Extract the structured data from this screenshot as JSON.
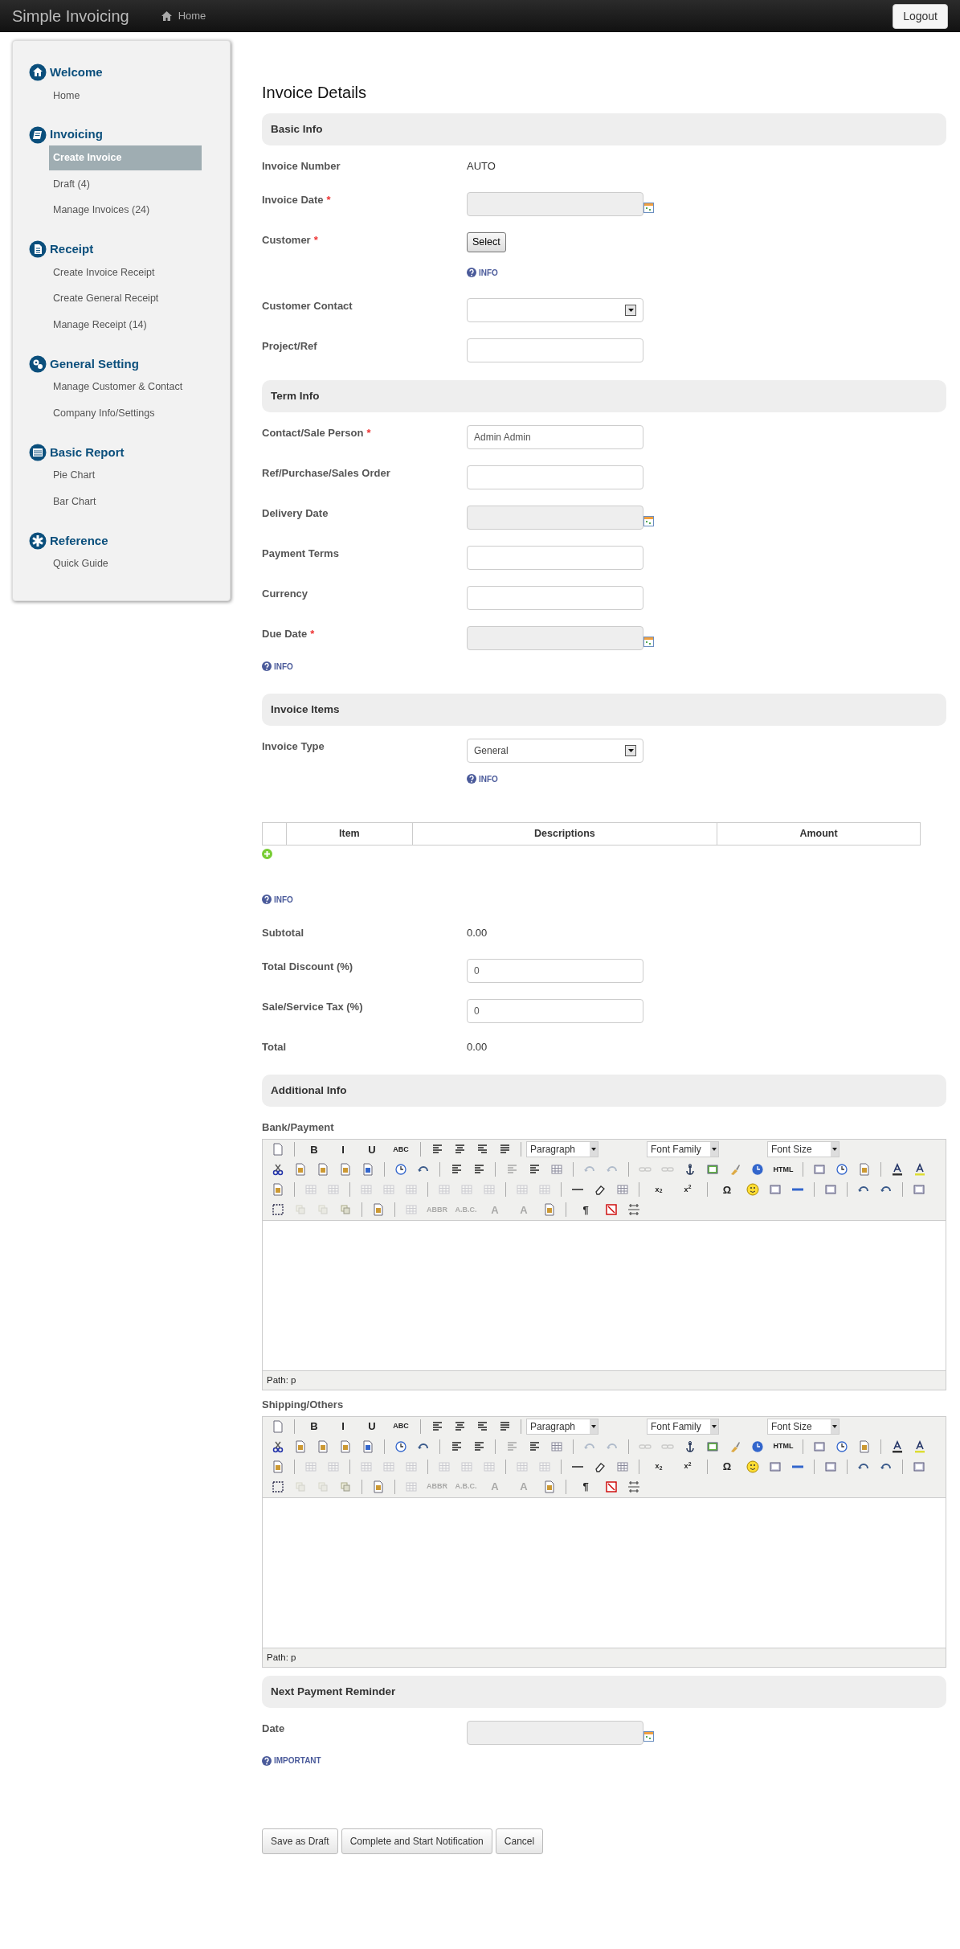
{
  "navbar": {
    "brand": "Simple Invoicing",
    "links": [
      {
        "label": "Home",
        "selected": false
      }
    ],
    "logout": "Logout"
  },
  "sidebar": {
    "groups": [
      {
        "kind": "home",
        "title": "Welcome",
        "items": [
          {
            "label": "Home",
            "selected": false
          }
        ]
      },
      {
        "kind": "invoice",
        "title": "Invoicing",
        "items": [
          {
            "label": "Create Invoice",
            "selected": true
          },
          {
            "label": "Draft (4)",
            "selected": false
          },
          {
            "label": "Manage Invoices (24)",
            "selected": false
          }
        ]
      },
      {
        "kind": "receipt",
        "title": "Receipt",
        "items": [
          {
            "label": "Create Invoice Receipt",
            "selected": false
          },
          {
            "label": "Create General Receipt",
            "selected": false
          },
          {
            "label": "Manage Receipt (14)",
            "selected": false
          }
        ]
      },
      {
        "kind": "setting",
        "title": "General Setting",
        "items": [
          {
            "label": "Manage Customer & Contact",
            "selected": false
          },
          {
            "label": "Company Info/Settings",
            "selected": false
          }
        ]
      },
      {
        "kind": "report",
        "title": "Basic Report",
        "items": [
          {
            "label": "Pie Chart",
            "selected": false
          },
          {
            "label": "Bar Chart",
            "selected": false
          }
        ]
      },
      {
        "kind": "reference",
        "title": "Reference",
        "items": [
          {
            "label": "Quick Guide",
            "selected": false
          }
        ]
      }
    ]
  },
  "content": {
    "title": "Invoice Details",
    "sections": [
      {
        "title": "Basic Info",
        "rows": [
          {
            "kind": "static",
            "label": "Invoice Number",
            "value": "AUTO"
          },
          {
            "kind": "date",
            "label": "Invoice Date",
            "required_mark": "*"
          },
          {
            "kind": "button",
            "label": "Customer",
            "required_mark": "*",
            "button": "Select"
          },
          {
            "kind": "field_info",
            "text": "INFO"
          },
          {
            "kind": "select",
            "label": "Customer Contact"
          },
          {
            "kind": "input",
            "label": "Project/Ref"
          }
        ]
      },
      {
        "title": "Term Info",
        "rows": [
          {
            "kind": "input",
            "label": "Contact/Sale Person",
            "required_mark": "*",
            "value": "Admin Admin"
          },
          {
            "kind": "input",
            "label": "Ref/Purchase/Sales Order"
          },
          {
            "kind": "date",
            "label": "Delivery Date"
          },
          {
            "kind": "input",
            "label": "Payment Terms"
          },
          {
            "kind": "input",
            "label": "Currency"
          },
          {
            "kind": "date",
            "label": "Due Date",
            "required_mark": "*"
          },
          {
            "kind": "info",
            "text": "INFO"
          }
        ]
      },
      {
        "title": "Invoice Items",
        "rows": [
          {
            "kind": "select",
            "label": "Invoice Type",
            "value": "General"
          },
          {
            "kind": "field_info",
            "text": "INFO"
          },
          {
            "kind": "items_table",
            "columns": [
              "Item",
              "Descriptions",
              "Amount"
            ]
          },
          {
            "kind": "info",
            "text": "INFO"
          },
          {
            "kind": "static",
            "label": "Subtotal",
            "value": "0.00"
          },
          {
            "kind": "input",
            "label": "Total Discount (%)",
            "value": "0"
          },
          {
            "kind": "input",
            "label": "Sale/Service Tax (%)",
            "value": "0"
          },
          {
            "kind": "static",
            "label": "Total",
            "value": "0.00"
          }
        ]
      },
      {
        "title": "Additional Info",
        "rows": [
          {
            "kind": "editor",
            "label": "Bank/Payment",
            "path": "Path: p",
            "toolbar": [
              [
                {
                  "kind": "icon",
                  "disabled": false
                },
                {
                  "kind": "sep"
                },
                {
                  "kind": "text",
                  "label": "B",
                  "disabled": false
                },
                {
                  "kind": "text",
                  "label": "I",
                  "disabled": false
                },
                {
                  "kind": "text",
                  "label": "U",
                  "disabled": false
                },
                {
                  "kind": "text",
                  "label": "ABC",
                  "disabled": false
                },
                {
                  "kind": "sep"
                },
                {
                  "kind": "icon",
                  "disabled": false
                },
                {
                  "kind": "icon",
                  "disabled": false
                },
                {
                  "kind": "icon",
                  "disabled": false
                },
                {
                  "kind": "icon",
                  "disabled": false
                },
                {
                  "kind": "sep"
                },
                {
                  "kind": "select",
                  "label": "Paragraph"
                },
                {
                  "kind": "select",
                  "label": "Font Family"
                },
                {
                  "kind": "select",
                  "label": "Font Size"
                }
              ],
              [
                {
                  "kind": "icon",
                  "disabled": false
                },
                {
                  "kind": "icon",
                  "disabled": false
                },
                {
                  "kind": "icon",
                  "disabled": false
                },
                {
                  "kind": "icon",
                  "disabled": false
                },
                {
                  "kind": "icon",
                  "disabled": false
                },
                {
                  "kind": "sep"
                },
                {
                  "kind": "icon",
                  "disabled": false
                },
                {
                  "kind": "icon",
                  "disabled": false
                },
                {
                  "kind": "sep"
                },
                {
                  "kind": "icon",
                  "disabled": false
                },
                {
                  "kind": "icon",
                  "disabled": false
                },
                {
                  "kind": "sep"
                },
                {
                  "kind": "icon",
                  "disabled": true
                },
                {
                  "kind": "icon",
                  "disabled": false
                },
                {
                  "kind": "icon",
                  "disabled": false
                },
                {
                  "kind": "sep"
                },
                {
                  "kind": "icon",
                  "disabled": true
                },
                {
                  "kind": "icon",
                  "disabled": true
                },
                {
                  "kind": "sep"
                },
                {
                  "kind": "icon",
                  "disabled": true
                },
                {
                  "kind": "icon",
                  "disabled": true
                },
                {
                  "kind": "icon",
                  "disabled": false
                },
                {
                  "kind": "icon",
                  "disabled": false
                },
                {
                  "kind": "icon",
                  "disabled": false
                },
                {
                  "kind": "icon",
                  "disabled": false
                },
                {
                  "kind": "text",
                  "label": "HTML",
                  "disabled": false
                },
                {
                  "kind": "sep"
                },
                {
                  "kind": "icon",
                  "disabled": false
                },
                {
                  "kind": "icon",
                  "disabled": false
                },
                {
                  "kind": "icon",
                  "disabled": false
                },
                {
                  "kind": "sep"
                },
                {
                  "kind": "icon",
                  "disabled": false
                },
                {
                  "kind": "icon",
                  "disabled": false
                }
              ],
              [
                {
                  "kind": "icon",
                  "disabled": false
                },
                {
                  "kind": "sep"
                },
                {
                  "kind": "icon",
                  "disabled": true
                },
                {
                  "kind": "icon",
                  "disabled": true
                },
                {
                  "kind": "sep"
                },
                {
                  "kind": "icon",
                  "disabled": true
                },
                {
                  "kind": "icon",
                  "disabled": true
                },
                {
                  "kind": "icon",
                  "disabled": true
                },
                {
                  "kind": "sep"
                },
                {
                  "kind": "icon",
                  "disabled": true
                },
                {
                  "kind": "icon",
                  "disabled": true
                },
                {
                  "kind": "icon",
                  "disabled": true
                },
                {
                  "kind": "sep"
                },
                {
                  "kind": "icon",
                  "disabled": true
                },
                {
                  "kind": "icon",
                  "disabled": true
                },
                {
                  "kind": "sep"
                },
                {
                  "kind": "icon",
                  "disabled": false
                },
                {
                  "kind": "icon",
                  "disabled": false
                },
                {
                  "kind": "icon",
                  "disabled": false
                },
                {
                  "kind": "sep"
                },
                {
                  "kind": "text",
                  "label": "x$_{2}$",
                  "disabled": false
                },
                {
                  "kind": "text",
                  "label": "x$^{2}$",
                  "disabled": false
                },
                {
                  "kind": "sep"
                },
                {
                  "kind": "text",
                  "label": "Ω",
                  "disabled": false
                },
                {
                  "kind": "icon",
                  "disabled": false
                },
                {
                  "kind": "icon",
                  "disabled": false
                },
                {
                  "kind": "icon",
                  "disabled": false
                },
                {
                  "kind": "sep"
                },
                {
                  "kind": "icon",
                  "disabled": false
                },
                {
                  "kind": "sep"
                },
                {
                  "kind": "icon",
                  "disabled": false
                },
                {
                  "kind": "icon",
                  "disabled": false
                },
                {
                  "kind": "sep"
                },
                {
                  "kind": "icon",
                  "disabled": false
                }
              ],
              [
                {
                  "kind": "icon",
                  "disabled": false
                },
                {
                  "kind": "icon",
                  "disabled": true
                },
                {
                  "kind": "icon",
                  "disabled": true
                },
                {
                  "kind": "icon",
                  "disabled": false
                },
                {
                  "kind": "sep"
                },
                {
                  "kind": "icon",
                  "disabled": false
                },
                {
                  "kind": "sep"
                },
                {
                  "kind": "icon",
                  "disabled": true
                },
                {
                  "kind": "text",
                  "label": "ABBR",
                  "disabled": true
                },
                {
                  "kind": "text",
                  "label": "A.B.C.",
                  "disabled": true
                },
                {
                  "kind": "text",
                  "label": "A",
                  "disabled": true
                },
                {
                  "kind": "text",
                  "label": "A",
                  "disabled": true
                },
                {
                  "kind": "icon",
                  "disabled": false
                },
                {
                  "kind": "sep"
                },
                {
                  "kind": "text",
                  "label": "¶",
                  "disabled": false
                },
                {
                  "kind": "icon",
                  "disabled": false
                },
                {
                  "kind": "icon",
                  "disabled": false
                }
              ]
            ]
          },
          {
            "kind": "editor",
            "label": "Shipping/Others",
            "path": "Path: p",
            "toolbar": [
              [
                {
                  "kind": "icon",
                  "disabled": false
                },
                {
                  "kind": "sep"
                },
                {
                  "kind": "text",
                  "label": "B",
                  "disabled": false
                },
                {
                  "kind": "text",
                  "label": "I",
                  "disabled": false
                },
                {
                  "kind": "text",
                  "label": "U",
                  "disabled": false
                },
                {
                  "kind": "text",
                  "label": "ABC",
                  "disabled": false
                },
                {
                  "kind": "sep"
                },
                {
                  "kind": "icon",
                  "disabled": false
                },
                {
                  "kind": "icon",
                  "disabled": false
                },
                {
                  "kind": "icon",
                  "disabled": false
                },
                {
                  "kind": "icon",
                  "disabled": false
                },
                {
                  "kind": "sep"
                },
                {
                  "kind": "select",
                  "label": "Paragraph"
                },
                {
                  "kind": "select",
                  "label": "Font Family"
                },
                {
                  "kind": "select",
                  "label": "Font Size"
                }
              ],
              [
                {
                  "kind": "icon",
                  "disabled": false
                },
                {
                  "kind": "icon",
                  "disabled": false
                },
                {
                  "kind": "icon",
                  "disabled": false
                },
                {
                  "kind": "icon",
                  "disabled": false
                },
                {
                  "kind": "icon",
                  "disabled": false
                },
                {
                  "kind": "sep"
                },
                {
                  "kind": "icon",
                  "disabled": false
                },
                {
                  "kind": "icon",
                  "disabled": false
                },
                {
                  "kind": "sep"
                },
                {
                  "kind": "icon",
                  "disabled": false
                },
                {
                  "kind": "icon",
                  "disabled": false
                },
                {
                  "kind": "sep"
                },
                {
                  "kind": "icon",
                  "disabled": true
                },
                {
                  "kind": "icon",
                  "disabled": false
                },
                {
                  "kind": "icon",
                  "disabled": false
                },
                {
                  "kind": "sep"
                },
                {
                  "kind": "icon",
                  "disabled": true
                },
                {
                  "kind": "icon",
                  "disabled": true
                },
                {
                  "kind": "sep"
                },
                {
                  "kind": "icon",
                  "disabled": true
                },
                {
                  "kind": "icon",
                  "disabled": true
                },
                {
                  "kind": "icon",
                  "disabled": false
                },
                {
                  "kind": "icon",
                  "disabled": false
                },
                {
                  "kind": "icon",
                  "disabled": false
                },
                {
                  "kind": "icon",
                  "disabled": false
                },
                {
                  "kind": "text",
                  "label": "HTML",
                  "disabled": false
                },
                {
                  "kind": "sep"
                },
                {
                  "kind": "icon",
                  "disabled": false
                },
                {
                  "kind": "icon",
                  "disabled": false
                },
                {
                  "kind": "icon",
                  "disabled": false
                },
                {
                  "kind": "sep"
                },
                {
                  "kind": "icon",
                  "disabled": false
                },
                {
                  "kind": "icon",
                  "disabled": false
                }
              ],
              [
                {
                  "kind": "icon",
                  "disabled": false
                },
                {
                  "kind": "sep"
                },
                {
                  "kind": "icon",
                  "disabled": true
                },
                {
                  "kind": "icon",
                  "disabled": true
                },
                {
                  "kind": "sep"
                },
                {
                  "kind": "icon",
                  "disabled": true
                },
                {
                  "kind": "icon",
                  "disabled": true
                },
                {
                  "kind": "icon",
                  "disabled": true
                },
                {
                  "kind": "sep"
                },
                {
                  "kind": "icon",
                  "disabled": true
                },
                {
                  "kind": "icon",
                  "disabled": true
                },
                {
                  "kind": "icon",
                  "disabled": true
                },
                {
                  "kind": "sep"
                },
                {
                  "kind": "icon",
                  "disabled": true
                },
                {
                  "kind": "icon",
                  "disabled": true
                },
                {
                  "kind": "sep"
                },
                {
                  "kind": "icon",
                  "disabled": false
                },
                {
                  "kind": "icon",
                  "disabled": false
                },
                {
                  "kind": "icon",
                  "disabled": false
                },
                {
                  "kind": "sep"
                },
                {
                  "kind": "text",
                  "label": "x$_{2}$",
                  "disabled": false
                },
                {
                  "kind": "text",
                  "label": "x$^{2}$",
                  "disabled": false
                },
                {
                  "kind": "sep"
                },
                {
                  "kind": "text",
                  "label": "Ω",
                  "disabled": false
                },
                {
                  "kind": "icon",
                  "disabled": false
                },
                {
                  "kind": "icon",
                  "disabled": false
                },
                {
                  "kind": "icon",
                  "disabled": false
                },
                {
                  "kind": "sep"
                },
                {
                  "kind": "icon",
                  "disabled": false
                },
                {
                  "kind": "sep"
                },
                {
                  "kind": "icon",
                  "disabled": false
                },
                {
                  "kind": "icon",
                  "disabled": false
                },
                {
                  "kind": "sep"
                },
                {
                  "kind": "icon",
                  "disabled": false
                }
              ],
              [
                {
                  "kind": "icon",
                  "disabled": false
                },
                {
                  "kind": "icon",
                  "disabled": true
                },
                {
                  "kind": "icon",
                  "disabled": true
                },
                {
                  "kind": "icon",
                  "disabled": false
                },
                {
                  "kind": "sep"
                },
                {
                  "kind": "icon",
                  "disabled": false
                },
                {
                  "kind": "sep"
                },
                {
                  "kind": "icon",
                  "disabled": true
                },
                {
                  "kind": "text",
                  "label": "ABBR",
                  "disabled": true
                },
                {
                  "kind": "text",
                  "label": "A.B.C.",
                  "disabled": true
                },
                {
                  "kind": "text",
                  "label": "A",
                  "disabled": true
                },
                {
                  "kind": "text",
                  "label": "A",
                  "disabled": true
                },
                {
                  "kind": "icon",
                  "disabled": false
                },
                {
                  "kind": "sep"
                },
                {
                  "kind": "text",
                  "label": "¶",
                  "disabled": false
                },
                {
                  "kind": "icon",
                  "disabled": false
                },
                {
                  "kind": "icon",
                  "disabled": false
                }
              ]
            ]
          }
        ]
      },
      {
        "title": "Next Payment Reminder",
        "rows": [
          {
            "kind": "date",
            "label": "Date"
          },
          {
            "kind": "info",
            "text": "IMPORTANT"
          }
        ]
      }
    ],
    "actions": [
      "Save as Draft",
      "Complete and Start Notification",
      "Cancel"
    ]
  }
}
